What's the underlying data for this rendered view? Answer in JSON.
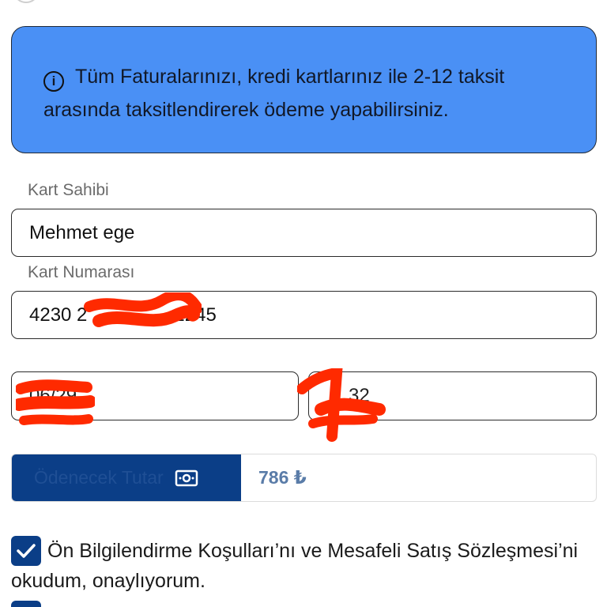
{
  "info": {
    "icon": "info-circle-icon",
    "text": "Tüm Faturalarınızı, kredi kartlarınız ile 2-12 taksit arasında taksitlendirerek ödeme yapabilirsiniz."
  },
  "card_holder": {
    "label": "Kart Sahibi",
    "value": "Mehmet ege"
  },
  "card_number": {
    "label": "Kart Numarası",
    "value_start": "4230 2",
    "value_end": "2245"
  },
  "expiry": {
    "value": "06/29"
  },
  "cvv": {
    "value": "32"
  },
  "amount": {
    "label": "Ödenecek Tutar",
    "icon": "money-icon",
    "value": "786 ₺"
  },
  "consent": {
    "checked": true,
    "text": "Ön Bilgilendirme Koşulları’nı ve Mesafeli Satış Sözleşmesi’ni okudum, onaylıyorum."
  },
  "colors": {
    "info_bg": "#4a90f5",
    "primary": "#0b3e87",
    "redaction": "#ff2a00"
  }
}
